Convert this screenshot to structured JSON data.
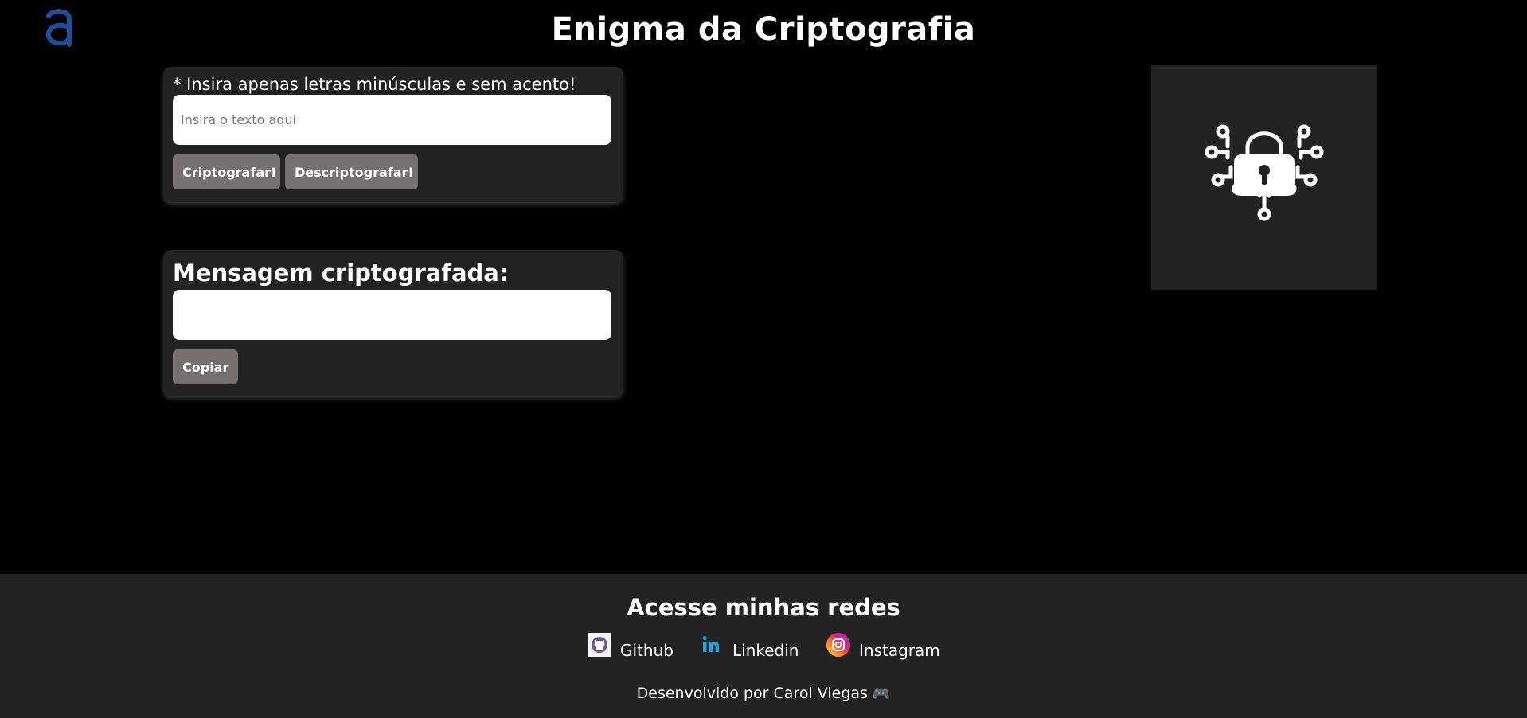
{
  "header": {
    "logo_icon": "letter-a-logo-icon",
    "logo_color": "#1f4e99",
    "title": "Enigma da Criptografia"
  },
  "encrypt_card": {
    "hint": "* Insira apenas letras minúsculas e sem acento!",
    "input_value": "",
    "input_placeholder": "Insira o texto aqui",
    "encrypt_label": "Criptografar!",
    "decrypt_label": "Descriptografar!"
  },
  "result_card": {
    "title": "Mensagem criptografada:",
    "output_value": "",
    "copy_label": "Copiar"
  },
  "illustration": {
    "icon": "digital-padlock-icon"
  },
  "footer": {
    "title": "Acesse minhas redes",
    "links": [
      {
        "label": "Github",
        "icon": "github-icon"
      },
      {
        "label": "Linkedin",
        "icon": "linkedin-icon"
      },
      {
        "label": "Instagram",
        "icon": "instagram-icon"
      }
    ],
    "credit": "Desenvolvido por Carol Viegas",
    "credit_icon": "gamepad-icon"
  },
  "colors": {
    "background": "#000000",
    "card": "#222222",
    "button": "#767171",
    "footer": "#232323",
    "linkedin": "#20a8d8"
  }
}
